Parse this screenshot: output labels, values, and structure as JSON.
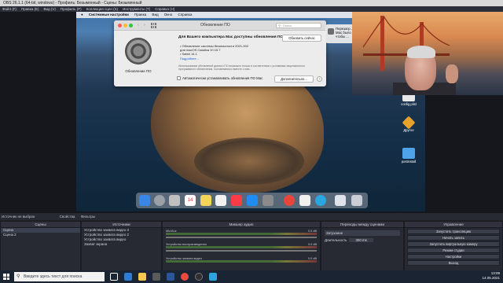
{
  "obs": {
    "title": "OBS 26.1.1 (64-bit, windows) - Профиль: Безымянный - Сцены: Безымянный",
    "menu": [
      "Файл (F)",
      "Правка (E)",
      "Вид (V)",
      "Профиль (P)",
      "Коллекция сцен (S)",
      "Инструменты (T)",
      "Справка (H)"
    ],
    "source_line": "Источник не выбран",
    "source_tabs": [
      "Свойства",
      "Фильтры"
    ],
    "panels": {
      "scenes": {
        "title": "Сцены",
        "items": [
          "Сцена",
          "Сцена 2"
        ]
      },
      "sources": {
        "title": "Источники",
        "items": [
          "Устройство захвата видео 3",
          "Устройство захвата видео 2",
          "Устройство захвата видео",
          "Захват экрана"
        ]
      },
      "mixer": {
        "title": "Микшер аудио",
        "channels": [
          {
            "name": "Mic/Aux",
            "level": "0.0 dB"
          },
          {
            "name": "Устройство воспроизведения",
            "level": "0.0 dB"
          },
          {
            "name": "Устройство захвата видео",
            "level": "0.0 dB"
          }
        ]
      },
      "transitions": {
        "title": "Переходы между сценами",
        "type": "Затухание",
        "duration_label": "Длительность",
        "duration": "300 ms"
      },
      "controls": {
        "title": "Управление",
        "buttons": [
          "Запустить трансляцию",
          "Начать запись",
          "Запустить виртуальную камеру",
          "Режим студии",
          "Настройки",
          "Выход"
        ]
      }
    },
    "status": {
      "live": "LIVE: 00:00:00",
      "rec": "REC: 00:00:00",
      "cpu": "CPU: 14.0%, 30.00 fps"
    }
  },
  "mac": {
    "menubar": {
      "app": "Системные настройки",
      "items": [
        "Правка",
        "Вид",
        "Окно",
        "Справка"
      ]
    },
    "update_window": {
      "title": "Обновление ПО",
      "search_placeholder": "Поиск",
      "icon_label": "Обновление ПО",
      "heading": "Для Вашего компьютера Mac доступны обновления ПО",
      "update_now": "Обновить сейчас",
      "items": [
        "• Обновление системы безопасности 2021-002",
        "для macOS Catalina 10.15.7",
        "• Safari 14.1"
      ],
      "more": "Подробнее...",
      "info": "Использование обновлений данного ПО возможно только в соответствии с условиями лицензионного программного обеспечения, поставляемого вместе с ним...",
      "auto_label": "Автоматически устанавливать обновления ПО Mac",
      "advanced": "Дополнительно...",
      "help": "?"
    },
    "notification": {
      "title": "Перезагр...",
      "body": "Mac было чтобы ..."
    },
    "desktop_icons": [
      "config.plist",
      "Другое",
      "postinstall"
    ]
  },
  "windows": {
    "search_placeholder": "Введите здесь текст для поиска",
    "clock": {
      "time": "13:09",
      "date": "14.05.2021"
    }
  }
}
